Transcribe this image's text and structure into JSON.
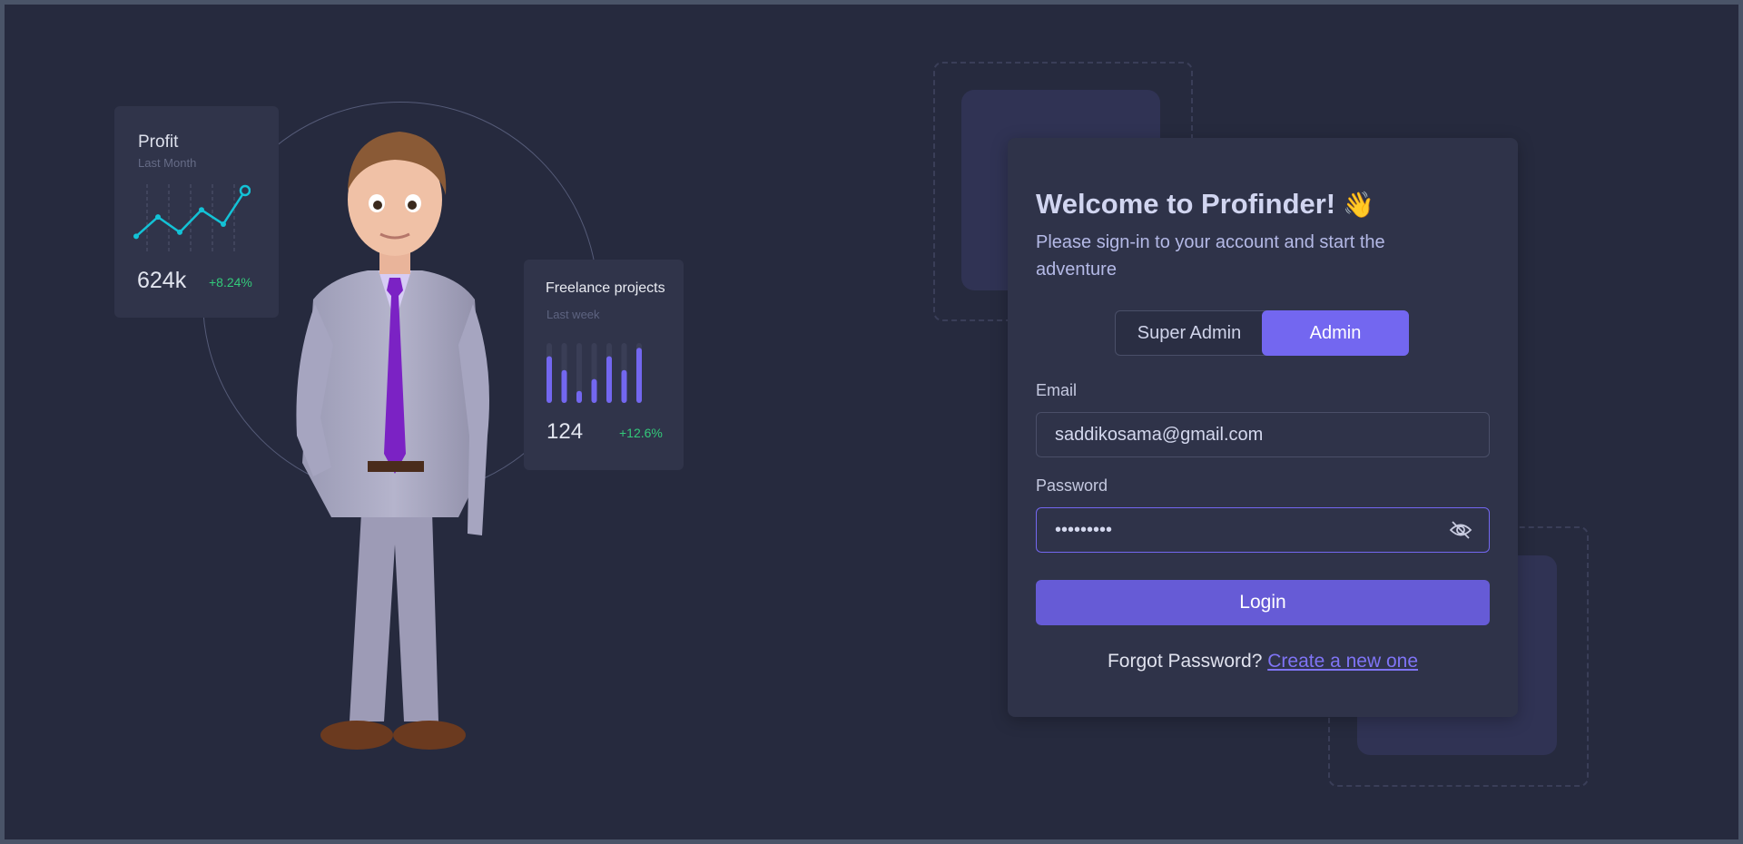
{
  "profit_card": {
    "title": "Profit",
    "subtitle": "Last Month",
    "value": "624k",
    "change": "+8.24%",
    "line_color": "#13c2d6",
    "trend_levels": [
      0.1,
      0.48,
      0.18,
      0.62,
      0.34,
      1.0
    ]
  },
  "freelance_card": {
    "title": "Freelance projects",
    "subtitle": "Last week",
    "value": "124",
    "change": "+12.6%",
    "bar_color": "#7367f0",
    "bar_levels": [
      0.78,
      0.55,
      0.2,
      0.4,
      0.78,
      0.55,
      0.92
    ]
  },
  "illustration": {
    "icon": "businessman-character-illustration"
  },
  "login": {
    "title": "Welcome to Profinder!",
    "title_emoji": "👋",
    "subtitle": "Please sign-in to your account and start the adventure",
    "roles": [
      "Super Admin",
      "Admin"
    ],
    "selected_role": "Admin",
    "email_label": "Email",
    "email_value": "saddikosama@gmail.com",
    "password_label": "Password",
    "password_value": "•••••••••",
    "password_toggle_icon": "eye-off-icon",
    "login_label": "Login",
    "forgot_text": "Forgot Password?",
    "forgot_link": "Create a new one"
  },
  "colors": {
    "accent": "#7367f0",
    "positive": "#33c97a",
    "background": "#262a3e",
    "card": "#2f3349"
  }
}
